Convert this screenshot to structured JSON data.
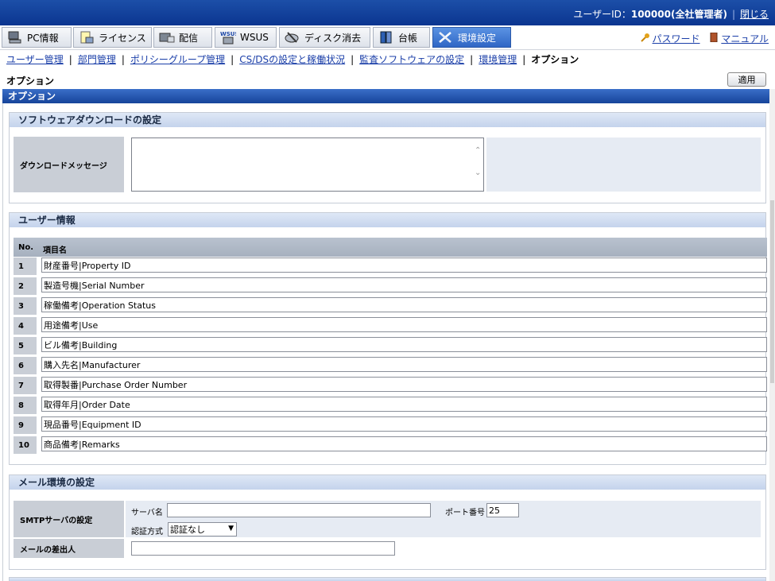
{
  "header": {
    "user_label": "ユーザーID：",
    "user_value": "100000(全社管理者)",
    "close_label": "閉じる"
  },
  "tabs": [
    {
      "label": "PC情報",
      "icon": "pc-icon"
    },
    {
      "label": "ライセンス",
      "icon": "license-icon"
    },
    {
      "label": "配信",
      "icon": "delivery-icon"
    },
    {
      "label": "WSUS",
      "icon": "wsus-icon",
      "badge": "WSUS"
    },
    {
      "label": "ディスク消去",
      "icon": "disk-erase-icon"
    },
    {
      "label": "台帳",
      "icon": "ledger-icon"
    },
    {
      "label": "環境設定",
      "icon": "tools-icon"
    }
  ],
  "toplinks": {
    "password": "パスワード",
    "manual": "マニュアル"
  },
  "subnav": {
    "items": [
      "ユーザー管理",
      "部門管理",
      "ポリシーグループ管理",
      "CS/DSの設定と稼働状況",
      "監査ソフトウェアの設定",
      "環境管理"
    ],
    "current": "オプション"
  },
  "page": {
    "title": "オプション",
    "apply": "適用",
    "section_title": "オプション"
  },
  "download": {
    "heading": "ソフトウェアダウンロードの設定",
    "label": "ダウンロードメッセージ",
    "value": ""
  },
  "userinfo": {
    "heading": "ユーザー情報",
    "col_no": "No.",
    "col_name": "項目名",
    "rows": [
      {
        "no": "1",
        "value": "財産番号|Property ID"
      },
      {
        "no": "2",
        "value": "製造号機|Serial Number"
      },
      {
        "no": "3",
        "value": "稼働備考|Operation Status"
      },
      {
        "no": "4",
        "value": "用途備考|Use"
      },
      {
        "no": "5",
        "value": "ビル備考|Building"
      },
      {
        "no": "6",
        "value": "購入先名|Manufacturer"
      },
      {
        "no": "7",
        "value": "取得製番|Purchase Order Number"
      },
      {
        "no": "8",
        "value": "取得年月|Order Date"
      },
      {
        "no": "9",
        "value": "現品番号|Equipment ID"
      },
      {
        "no": "10",
        "value": "商品備考|Remarks"
      }
    ]
  },
  "mail": {
    "heading": "メール環境の設定",
    "smtp_label": "SMTPサーバの設定",
    "server_label": "サーバ名",
    "server_value": "",
    "port_label": "ポート番号",
    "port_value": "25",
    "auth_label": "認証方式",
    "auth_value": "認証なし",
    "sender_label": "メールの差出人",
    "sender_value": ""
  },
  "colors": {
    "header": "#0b3590",
    "active_tab": "#2f66c5",
    "group_head": "#c4d3ec",
    "label_bg": "#c9ced6"
  }
}
